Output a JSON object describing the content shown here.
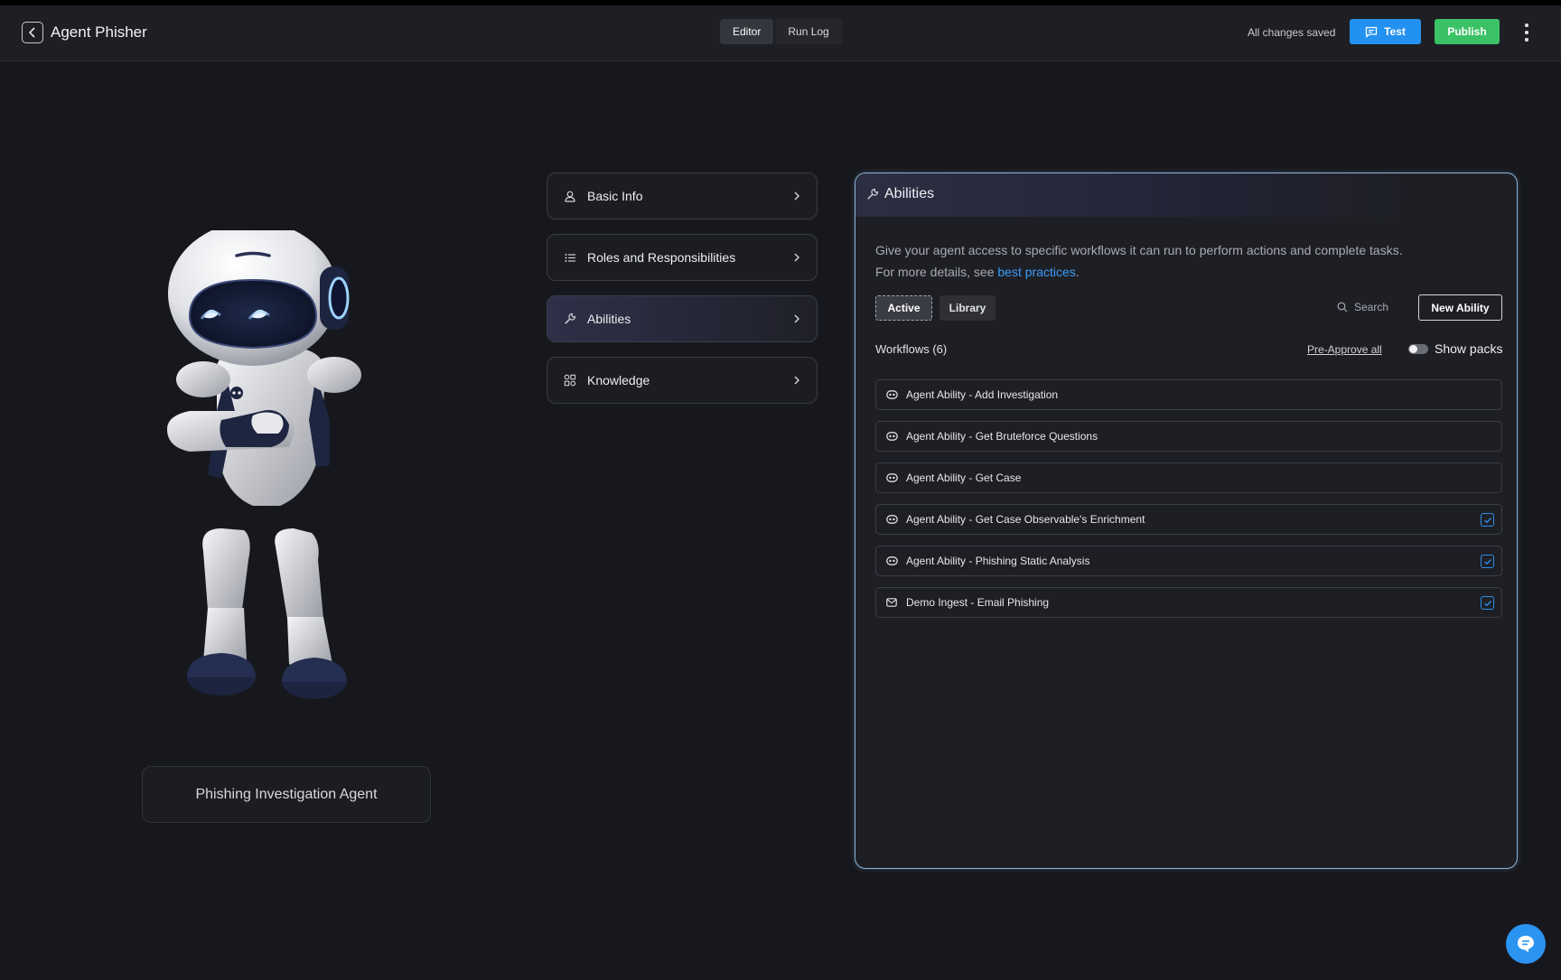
{
  "header": {
    "title": "Agent Phisher",
    "tabs": [
      {
        "label": "Editor"
      },
      {
        "label": "Run Log"
      }
    ],
    "save_status": "All changes saved",
    "test_label": "Test",
    "publish_label": "Publish"
  },
  "agent": {
    "name": "Phishing Investigation Agent"
  },
  "sections": [
    {
      "label": "Basic Info",
      "icon": "user-icon"
    },
    {
      "label": "Roles and Responsibilities",
      "icon": "list-icon"
    },
    {
      "label": "Abilities",
      "icon": "wrench-icon"
    },
    {
      "label": "Knowledge",
      "icon": "shapes-icon"
    }
  ],
  "abilities": {
    "title": "Abilities",
    "description_1": "Give your agent access to specific workflows it can run to perform actions and complete tasks.",
    "description_2": "For more details, see ",
    "link_text": "best practices",
    "description_end": ".",
    "tab_active": "Active",
    "tab_library": "Library",
    "search_placeholder": "Search",
    "new_button": "New Ability",
    "workflows_title": "Workflows (6)",
    "preapprove_label": "Pre-Approve all",
    "show_packs_label": "Show packs",
    "show_packs_enabled": false,
    "workflows": [
      {
        "label": "Agent Ability - Add Investigation",
        "icon": "agent-ability-icon",
        "approved": false
      },
      {
        "label": "Agent Ability - Get Bruteforce Questions",
        "icon": "agent-ability-icon",
        "approved": false
      },
      {
        "label": "Agent Ability - Get Case",
        "icon": "agent-ability-icon",
        "approved": false
      },
      {
        "label": "Agent Ability - Get Case Observable's Enrichment",
        "icon": "agent-ability-icon",
        "approved": true
      },
      {
        "label": "Agent Ability - Phishing Static Analysis",
        "icon": "agent-ability-icon",
        "approved": true
      },
      {
        "label": "Demo Ingest - Email Phishing",
        "icon": "mail-icon",
        "approved": true
      }
    ]
  },
  "colors": {
    "background": "#17181d",
    "accent_blue": "#2391f0",
    "publish_green": "#3cc266",
    "panel_border": "#8fb6d8"
  }
}
